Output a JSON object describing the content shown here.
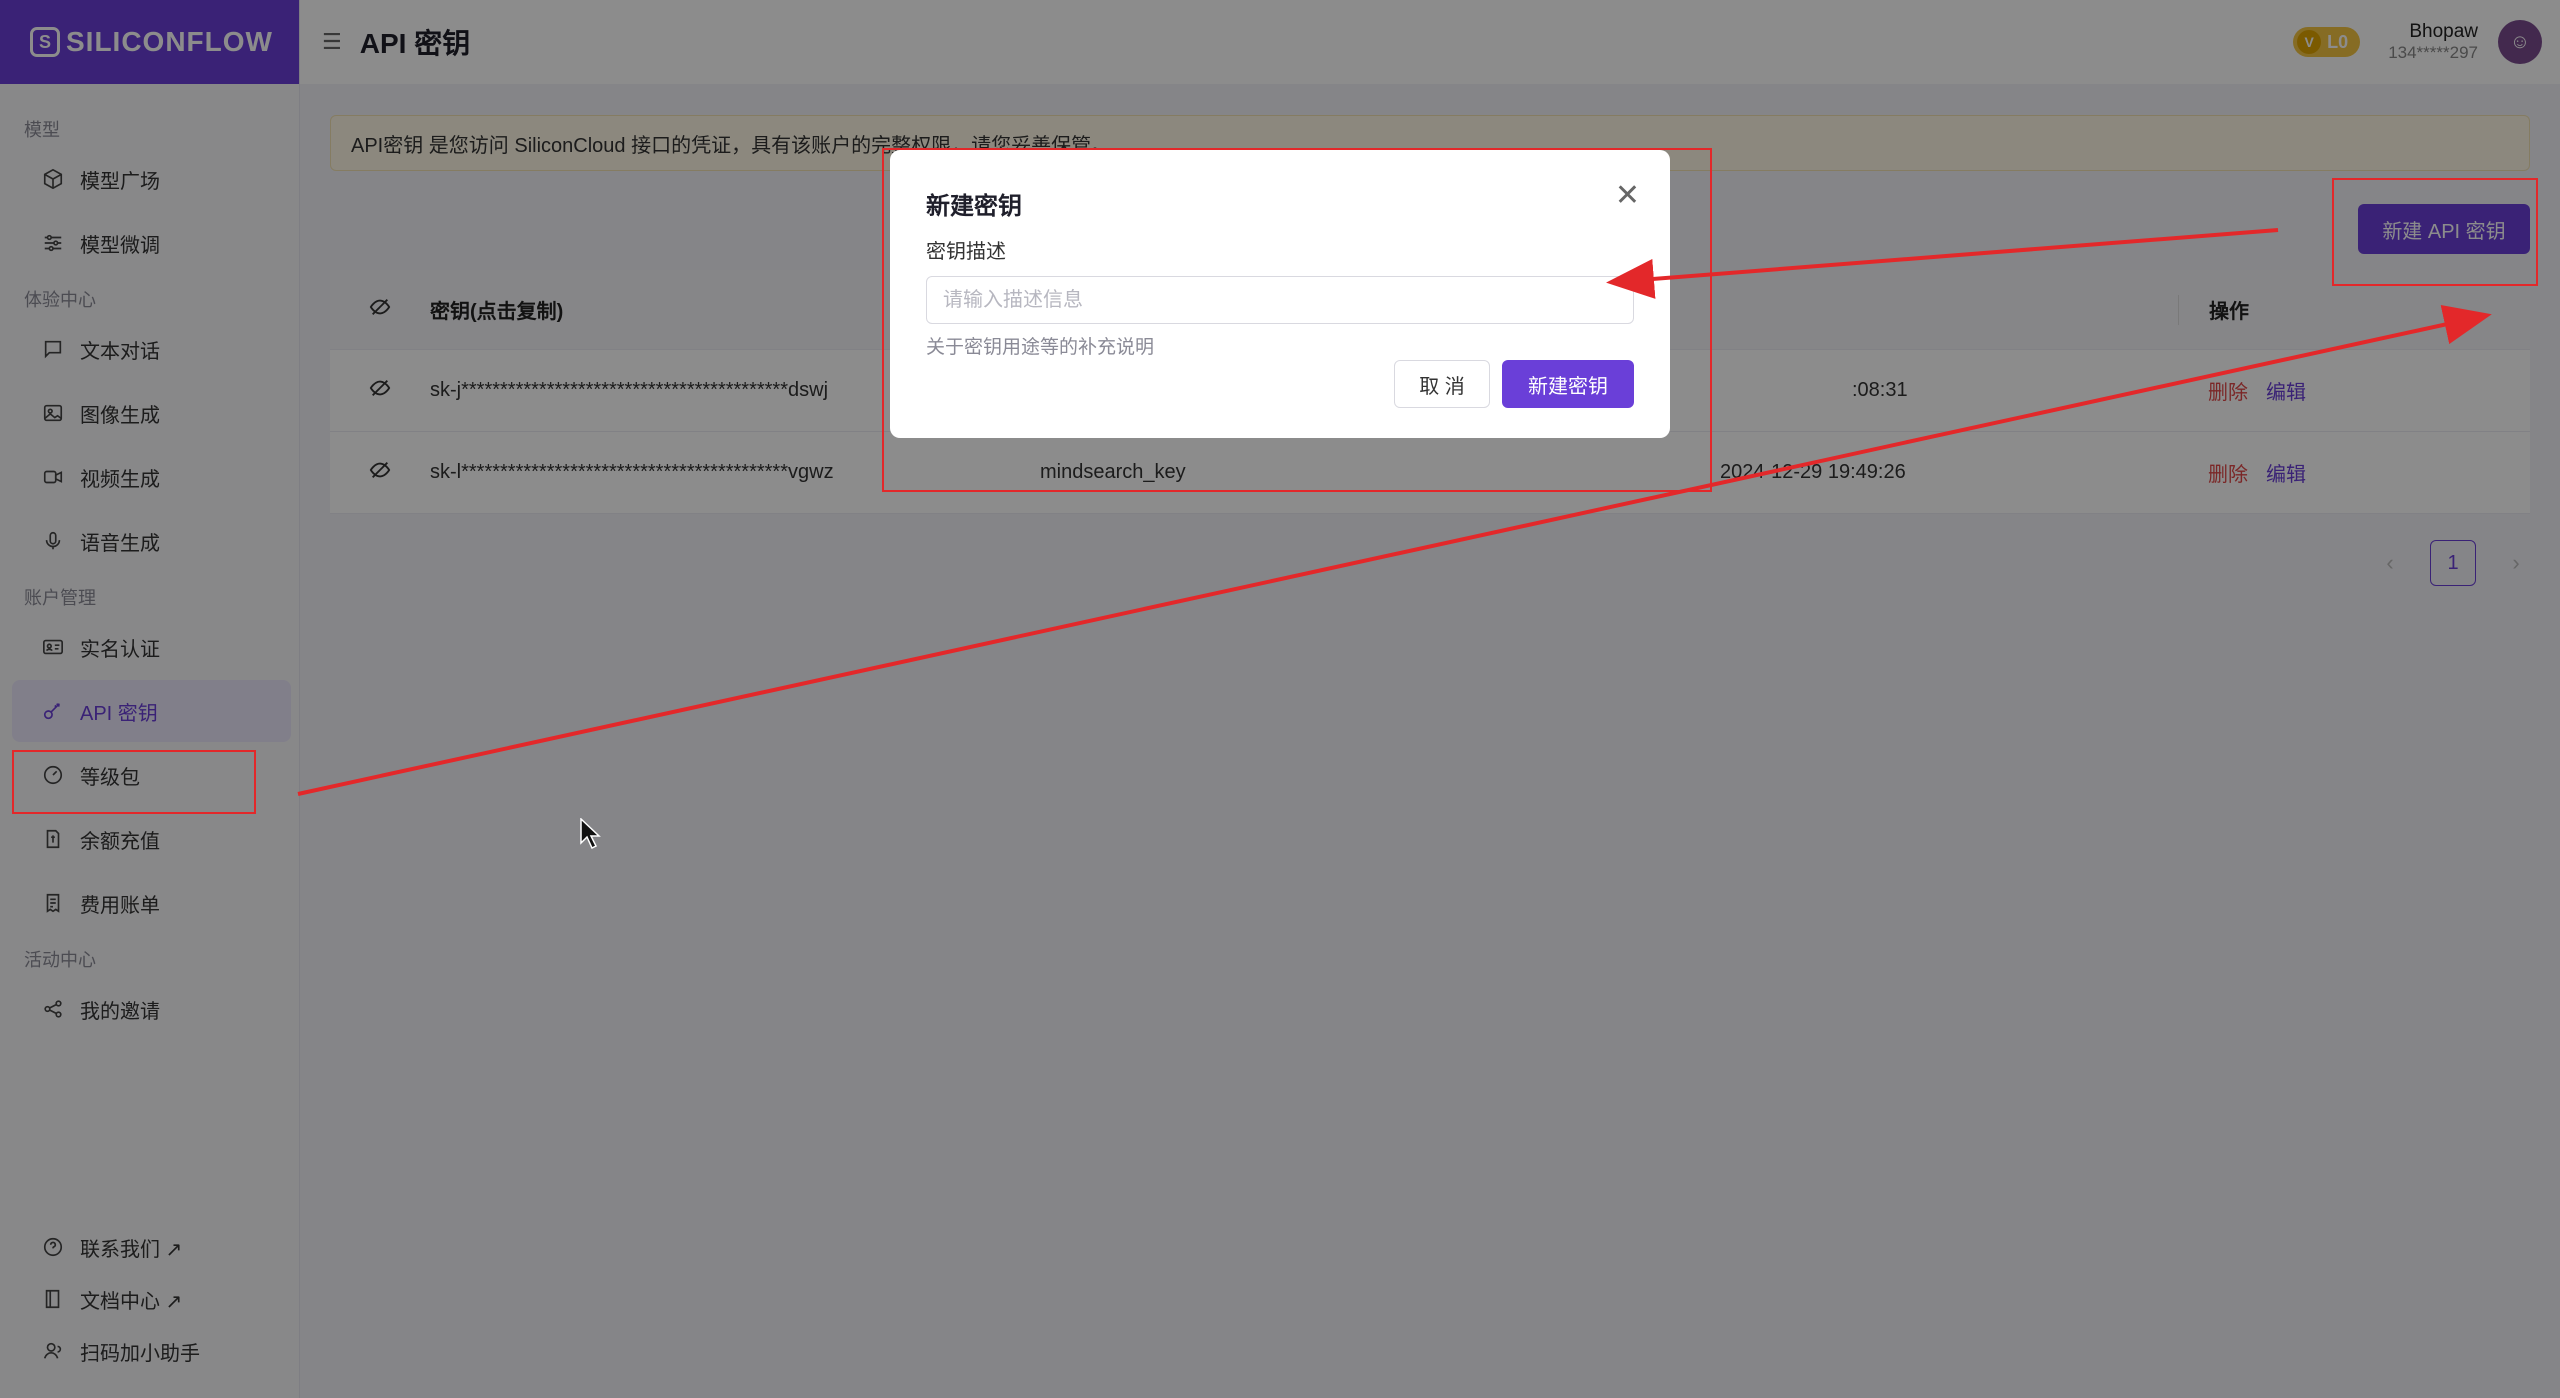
{
  "app": {
    "brand": "SILICONFLOW",
    "brand_mark": "S"
  },
  "header": {
    "title": "API 密钥",
    "level_badge": "L0",
    "level_prefix": "V",
    "user_name": "Bhopaw",
    "user_phone": "134*****297"
  },
  "sidebar": {
    "sections": [
      {
        "title": "模型",
        "items": [
          {
            "label": "模型广场",
            "icon": "cube-icon"
          },
          {
            "label": "模型微调",
            "icon": "sliders-icon"
          }
        ]
      },
      {
        "title": "体验中心",
        "items": [
          {
            "label": "文本对话",
            "icon": "chat-icon"
          },
          {
            "label": "图像生成",
            "icon": "image-icon"
          },
          {
            "label": "视频生成",
            "icon": "video-icon"
          },
          {
            "label": "语音生成",
            "icon": "mic-icon"
          }
        ]
      },
      {
        "title": "账户管理",
        "items": [
          {
            "label": "实名认证",
            "icon": "id-card-icon"
          },
          {
            "label": "API 密钥",
            "icon": "key-icon",
            "active": true
          },
          {
            "label": "等级包",
            "icon": "gauge-icon"
          },
          {
            "label": "余额充值",
            "icon": "wallet-icon"
          },
          {
            "label": "费用账单",
            "icon": "receipt-icon"
          }
        ]
      },
      {
        "title": "活动中心",
        "items": [
          {
            "label": "我的邀请",
            "icon": "share-icon"
          }
        ]
      }
    ],
    "bottom": [
      {
        "label": "联系我们 ↗"
      },
      {
        "label": "文档中心 ↗"
      },
      {
        "label": "扫码加小助手"
      }
    ]
  },
  "notice": "API密钥 是您访问 SiliconCloud 接口的凭证，具有该账户的完整权限，请您妥善保管。",
  "new_key_button": "新建 API 密钥",
  "table": {
    "headers": {
      "key": "密钥(点击复制)",
      "ops": "操作"
    },
    "rows": [
      {
        "key": "sk-j******************************************dswj",
        "desc": "",
        "time": ":08:31",
        "del": "删除",
        "edit": "编辑"
      },
      {
        "key": "sk-l******************************************vgwz",
        "desc": "mindsearch_key",
        "time": "2024-12-29 19:49:26",
        "del": "删除",
        "edit": "编辑"
      }
    ]
  },
  "pagination": {
    "prev": "‹",
    "current": "1",
    "next": "›"
  },
  "modal": {
    "title": "新建密钥",
    "field_label": "密钥描述",
    "placeholder": "请输入描述信息",
    "help": "关于密钥用途等的补充说明",
    "cancel": "取 消",
    "create": "新建密钥"
  },
  "colors": {
    "primary": "#6a3fd8",
    "danger": "#e04848",
    "annotation": "#e3282a"
  }
}
